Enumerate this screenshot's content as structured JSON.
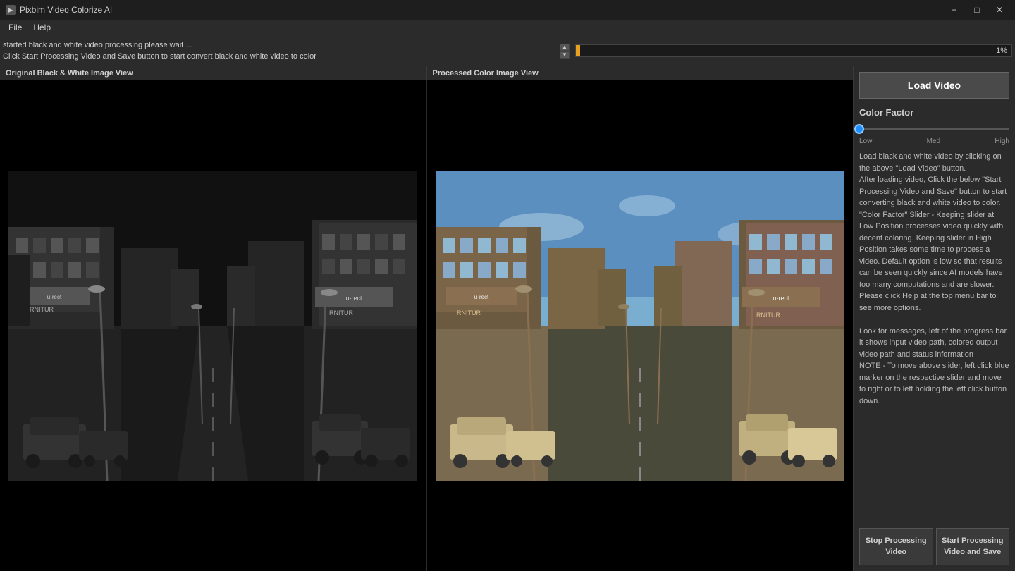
{
  "titlebar": {
    "title": "Pixbim Video Colorize AI",
    "minimize_label": "−",
    "maximize_label": "□",
    "close_label": "✕"
  },
  "menubar": {
    "items": [
      {
        "label": "File"
      },
      {
        "label": "Help"
      }
    ]
  },
  "status": {
    "line1": "started black and white video processing please wait ...",
    "line2": "Click Start Processing Video and Save button to start convert black and white video to color"
  },
  "progress": {
    "value": 1,
    "label": "1%"
  },
  "panels": {
    "left_label": "Original Black & White  Image View",
    "right_label": "Processed Color Image View"
  },
  "sidebar": {
    "load_video_label": "Load Video",
    "color_factor_label": "Color Factor",
    "slider_low": "Low",
    "slider_med": "Med",
    "slider_high": "High",
    "instructions": "Load black and white video by clicking on the above \"Load Video\" button.\nAfter loading video, Click the below \"Start Processing Video and Save\" button to start converting black and white video to color.\n\"Color Factor\" Slider - Keeping slider at Low Position processes video quickly with decent coloring. Keeping slider in High Position takes some time to process a video. Default option is low so that results can be seen quickly since AI models have too many computations and are slower. Please click Help at the top menu bar to see more options.\n\nLook for messages, left of the progress bar it shows input video path, colored output video path and status information\nNOTE - To move above slider, left click blue marker on the respective slider and move to right or to left holding the left click button down.",
    "stop_btn_line1": "Stop Processing",
    "stop_btn_line2": "Video",
    "start_btn_line1": "Start Processing",
    "start_btn_line2": "Video and Save"
  }
}
